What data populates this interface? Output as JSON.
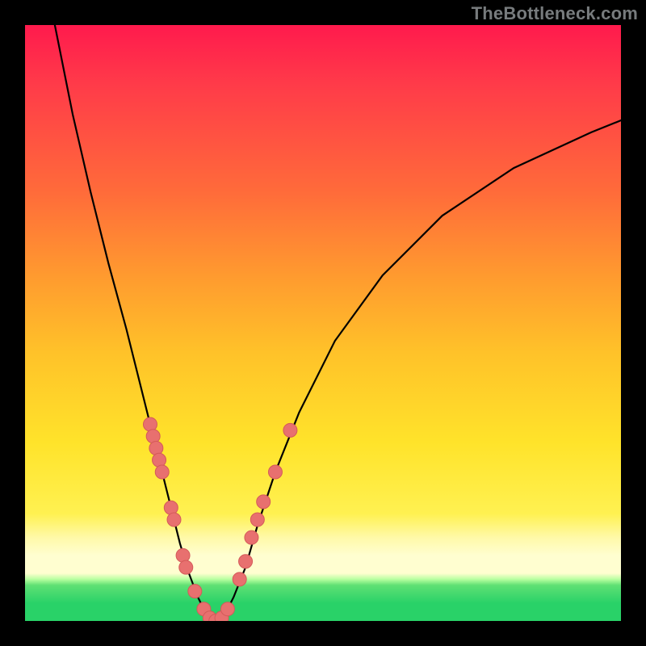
{
  "watermark": "TheBottleneck.com",
  "colors": {
    "frame": "#000000",
    "curve": "#000000",
    "dot_fill": "#e8706f",
    "dot_stroke": "#d45a59",
    "gradient_top": "#ff1a4d",
    "gradient_mid": "#ffe32a",
    "gradient_band": "#fffed0",
    "gradient_bottom": "#29d268",
    "watermark": "#777b7d"
  },
  "chart_data": {
    "type": "line",
    "title": "",
    "xlabel": "",
    "ylabel": "",
    "xlim": [
      0,
      100
    ],
    "ylim": [
      0,
      100
    ],
    "grid": false,
    "legend": false,
    "series": [
      {
        "name": "bottleneck-curve",
        "x": [
          5,
          8,
          11,
          14,
          17,
          19,
          21,
          23,
          24.5,
          26,
          27.5,
          29,
          30.5,
          32,
          33.5,
          35,
          37,
          39,
          42,
          46,
          52,
          60,
          70,
          82,
          95,
          100
        ],
        "y": [
          100,
          85,
          72,
          60,
          49,
          41,
          33,
          25,
          19,
          13,
          8,
          4,
          1,
          0,
          1,
          4,
          9,
          16,
          25,
          35,
          47,
          58,
          68,
          76,
          82,
          84
        ]
      }
    ],
    "points": [
      {
        "name": "cluster-dot",
        "x": 21.0,
        "y": 33
      },
      {
        "name": "cluster-dot",
        "x": 21.5,
        "y": 31
      },
      {
        "name": "cluster-dot",
        "x": 22.0,
        "y": 29
      },
      {
        "name": "cluster-dot",
        "x": 22.5,
        "y": 27
      },
      {
        "name": "cluster-dot",
        "x": 23.0,
        "y": 25
      },
      {
        "name": "cluster-dot",
        "x": 24.5,
        "y": 19
      },
      {
        "name": "cluster-dot",
        "x": 25.0,
        "y": 17
      },
      {
        "name": "cluster-dot",
        "x": 26.5,
        "y": 11
      },
      {
        "name": "cluster-dot",
        "x": 27.0,
        "y": 9
      },
      {
        "name": "cluster-dot",
        "x": 28.5,
        "y": 5
      },
      {
        "name": "cluster-dot",
        "x": 30.0,
        "y": 2
      },
      {
        "name": "cluster-dot",
        "x": 31.0,
        "y": 0.5
      },
      {
        "name": "cluster-dot",
        "x": 32.0,
        "y": 0
      },
      {
        "name": "cluster-dot",
        "x": 33.0,
        "y": 0.5
      },
      {
        "name": "cluster-dot",
        "x": 34.0,
        "y": 2
      },
      {
        "name": "cluster-dot",
        "x": 36.0,
        "y": 7
      },
      {
        "name": "cluster-dot",
        "x": 37.0,
        "y": 10
      },
      {
        "name": "cluster-dot",
        "x": 38.0,
        "y": 14
      },
      {
        "name": "cluster-dot",
        "x": 39.0,
        "y": 17
      },
      {
        "name": "cluster-dot",
        "x": 40.0,
        "y": 20
      },
      {
        "name": "cluster-dot",
        "x": 42.0,
        "y": 25
      },
      {
        "name": "cluster-dot",
        "x": 44.5,
        "y": 32
      }
    ],
    "annotations": []
  }
}
